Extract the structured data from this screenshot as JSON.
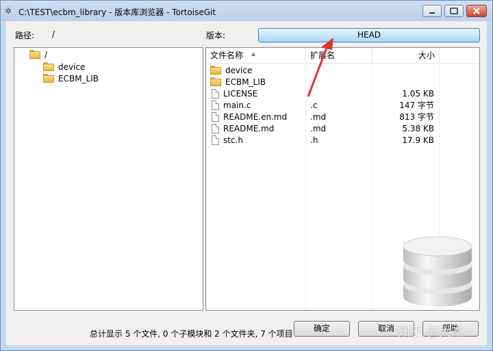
{
  "window": {
    "title": "C:\\TEST\\ecbm_library - 版本库浏览器 - TortoiseGit",
    "icon": "tortoisegit-icon"
  },
  "path": {
    "label": "路径:",
    "value": "/"
  },
  "version": {
    "label": "版本:",
    "value": "HEAD"
  },
  "tree": {
    "root": "/",
    "children": [
      "device",
      "ECBM_LIB"
    ]
  },
  "file_list": {
    "columns": [
      "文件名称",
      "扩展名",
      "大小"
    ],
    "rows": [
      {
        "icon": "folder-icon",
        "name": "device",
        "ext": "",
        "size": ""
      },
      {
        "icon": "folder-icon",
        "name": "ECBM_LIB",
        "ext": "",
        "size": ""
      },
      {
        "icon": "file-icon",
        "name": "LICENSE",
        "ext": "",
        "size": "1.05 KB"
      },
      {
        "icon": "file-icon",
        "name": "main.c",
        "ext": ".c",
        "size": "147 字节"
      },
      {
        "icon": "file-icon",
        "name": "README.en.md",
        "ext": ".md",
        "size": "813 字节"
      },
      {
        "icon": "file-icon",
        "name": "README.md",
        "ext": ".md",
        "size": "5.38 KB"
      },
      {
        "icon": "file-icon",
        "name": "stc.h",
        "ext": ".h",
        "size": "17.9 KB"
      }
    ]
  },
  "status": "总计显示 5 个文件, 0 个子模块和 2 个文件夹, 7 个项目",
  "buttons": {
    "ok": "确定",
    "cancel": "取消",
    "help": "帮助"
  },
  "watermark": "知乎 @大杰",
  "colors": {
    "annotation_arrow": "#e53030",
    "head_button": "#a9d5f5"
  }
}
